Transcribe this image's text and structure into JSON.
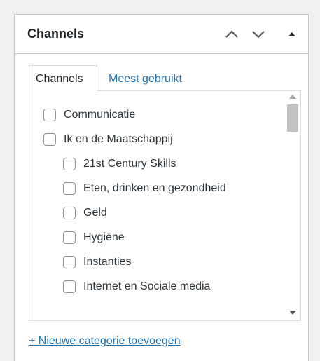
{
  "panel": {
    "title": "Channels",
    "move_up_label": "Move up",
    "move_down_label": "Move down",
    "toggle_label": "Toggle panel"
  },
  "tabs": [
    {
      "label": "Channels",
      "active": true
    },
    {
      "label": "Meest gebruikt",
      "active": false
    }
  ],
  "categories": [
    {
      "label": "Communicatie",
      "level": 0,
      "checked": false
    },
    {
      "label": "Ik en de Maatschappij",
      "level": 0,
      "checked": false
    },
    {
      "label": "21st Century Skills",
      "level": 1,
      "checked": false
    },
    {
      "label": "Eten, drinken en gezondheid",
      "level": 1,
      "checked": false
    },
    {
      "label": "Geld",
      "level": 1,
      "checked": false
    },
    {
      "label": "Hygiëne",
      "level": 1,
      "checked": false
    },
    {
      "label": "Instanties",
      "level": 1,
      "checked": false
    },
    {
      "label": "Internet en Sociale media",
      "level": 1,
      "checked": false
    }
  ],
  "add_category_link": "+ Nieuwe categorie toevoegen",
  "colors": {
    "link": "#2271b1",
    "border": "#c3c4c7",
    "background": "#f0f0f1"
  }
}
